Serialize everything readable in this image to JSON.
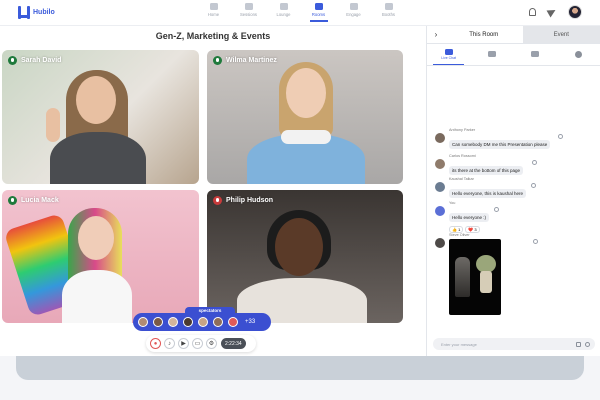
{
  "app": {
    "logo_text": "Hubilo"
  },
  "nav": [
    {
      "label": "Home"
    },
    {
      "label": "Sessions"
    },
    {
      "label": "Lounge"
    },
    {
      "label": "Rooms"
    },
    {
      "label": "Engage"
    },
    {
      "label": "Booths"
    }
  ],
  "stage": {
    "title": "Gen-Z, Marketing & Events",
    "participants": [
      {
        "name": "Sarah David",
        "mic": "on"
      },
      {
        "name": "Wilma Martinez",
        "mic": "on"
      },
      {
        "name": "Lucia Mack",
        "mic": "on"
      },
      {
        "name": "Philip Hudson",
        "mic": "off"
      }
    ]
  },
  "spectators": {
    "label": "spectators",
    "count": "+33"
  },
  "controls": {
    "timer": "2:22:34"
  },
  "panel": {
    "tabs": [
      {
        "label": "This Room"
      },
      {
        "label": "Event"
      }
    ],
    "subtabs": [
      {
        "label": "Live Chat"
      }
    ],
    "messages": [
      {
        "name": "Anthony Parker",
        "text": "Can somebody DM me this Presentation please",
        "avatar_color": "#7a6a5e"
      },
      {
        "name": "Carlos Rossomi",
        "text": "its there at the bottom of this page",
        "avatar_color": "#8f7b6b"
      },
      {
        "name": "Kaushal Talkar",
        "text": "Hello everyone, this is kaushal here",
        "avatar_color": "#6b7c92"
      },
      {
        "name": "You",
        "text": "Hello everyone :)",
        "avatar_color": "#5b6fd6",
        "reactions": [
          "👍 1",
          "❤️ 3"
        ]
      },
      {
        "name": "Steve Oliver",
        "avatar_color": "#4e4a48"
      }
    ],
    "composer_placeholder": "Enter your message"
  },
  "colors": {
    "accent": "#3b5bdb",
    "spectator_bar": "#3b4fd1",
    "mic_on": "#1f7a3c",
    "mic_off": "#c73b3b"
  }
}
